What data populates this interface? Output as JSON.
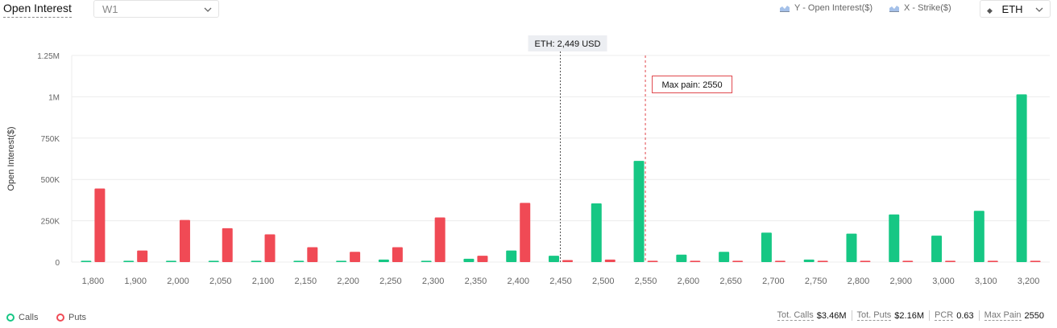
{
  "header": {
    "title": "Open Interest",
    "period": "W1",
    "y_axis_tag": "Y - Open Interest($)",
    "x_axis_tag": "X - Strike($)",
    "coin": "ETH"
  },
  "legend": {
    "calls": "Calls",
    "puts": "Puts"
  },
  "stats": [
    {
      "label": "Tot. Calls",
      "value": "$3.46M"
    },
    {
      "label": "Tot. Puts",
      "value": "$2.16M"
    },
    {
      "label": "PCR",
      "value": "0.63"
    },
    {
      "label": "Max Pain",
      "value": "2550"
    }
  ],
  "colors": {
    "calls": "#16c784",
    "puts": "#f04a55",
    "grid": "#ececec",
    "maxpain": "#e0474c"
  },
  "chart_data": {
    "type": "bar",
    "ylabel": "Open Interest($)",
    "ylim": [
      0,
      1250000
    ],
    "yticks": [
      0,
      250000,
      500000,
      750000,
      1000000,
      1250000
    ],
    "ytick_labels": [
      "0",
      "250K",
      "500K",
      "750K",
      "1M",
      "1.25M"
    ],
    "categories": [
      "1,800",
      "1,900",
      "2,000",
      "2,050",
      "2,100",
      "2,150",
      "2,200",
      "2,250",
      "2,300",
      "2,350",
      "2,400",
      "2,450",
      "2,500",
      "2,550",
      "2,600",
      "2,650",
      "2,700",
      "2,750",
      "2,800",
      "2,900",
      "3,000",
      "3,100",
      "3,200"
    ],
    "series": [
      {
        "name": "Calls",
        "values": [
          8000,
          8000,
          8000,
          8000,
          8000,
          8000,
          8000,
          15000,
          8000,
          20000,
          70000,
          38000,
          355000,
          612000,
          45000,
          62000,
          178000,
          15000,
          172000,
          288000,
          160000,
          310000,
          1015000
        ]
      },
      {
        "name": "Puts",
        "values": [
          445000,
          70000,
          255000,
          205000,
          168000,
          90000,
          62000,
          90000,
          270000,
          38000,
          358000,
          12000,
          15000,
          8000,
          8000,
          8000,
          8000,
          8000,
          8000,
          8000,
          8000,
          8000,
          8000
        ]
      }
    ],
    "annotations": {
      "spot_label": "ETH: 2,449 USD",
      "spot_index": 11,
      "maxpain_label": "Max pain: 2550",
      "maxpain_index": 13
    }
  }
}
